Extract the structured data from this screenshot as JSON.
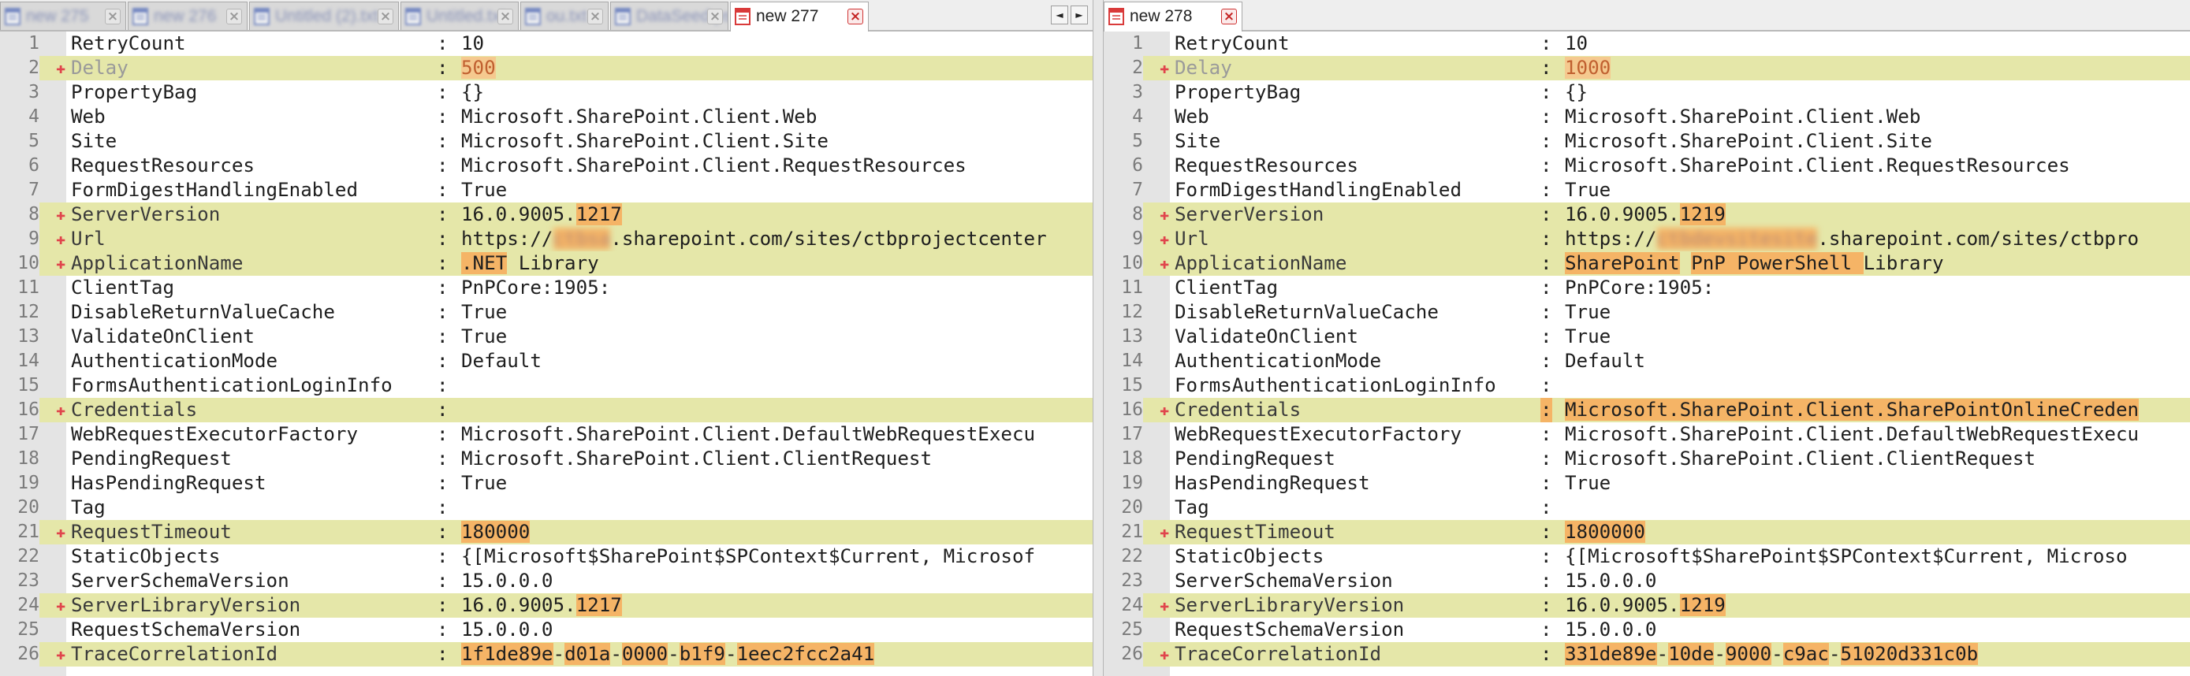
{
  "colors": {
    "diff_line_bg": "#e5e7a9",
    "char_highlight": "#f5b466",
    "marker": "#e0454c",
    "gutter": "#e4e4e4"
  },
  "left": {
    "tabs": [
      {
        "label": "new 275",
        "icon": "notepad-file-icon",
        "blurred": true
      },
      {
        "label": "new 276",
        "icon": "notepad-file-icon",
        "blurred": true
      },
      {
        "label": "Untitled (2).txt",
        "icon": "notepad-file-icon",
        "blurred": true
      },
      {
        "label": "Untitled.txt",
        "icon": "notepad-file-icon",
        "blurred": true
      },
      {
        "label": "ou.txt",
        "icon": "notepad-file-icon",
        "blurred": true
      },
      {
        "label": "DataSeed.ps1",
        "icon": "notepad-file-icon",
        "blurred": true
      },
      {
        "label": "new 277",
        "icon": "notepad-file-red-icon",
        "blurred": false,
        "active": true
      }
    ],
    "scroll_left": "◄",
    "scroll_right": "►",
    "lines": [
      {
        "n": "1",
        "k": "RetryCount",
        "v": [
          {
            "t": "10"
          }
        ]
      },
      {
        "n": "2",
        "d": true,
        "dim": true,
        "k": "Delay",
        "v": [
          {
            "t": "500",
            "h": true
          }
        ]
      },
      {
        "n": "3",
        "k": "PropertyBag",
        "v": [
          {
            "t": "{}"
          }
        ]
      },
      {
        "n": "4",
        "k": "Web",
        "v": [
          {
            "t": "Microsoft.SharePoint.Client.Web"
          }
        ]
      },
      {
        "n": "5",
        "k": "Site",
        "v": [
          {
            "t": "Microsoft.SharePoint.Client.Site"
          }
        ]
      },
      {
        "n": "6",
        "k": "RequestResources",
        "v": [
          {
            "t": "Microsoft.SharePoint.Client.RequestResources"
          }
        ]
      },
      {
        "n": "7",
        "k": "FormDigestHandlingEnabled",
        "v": [
          {
            "t": "True"
          }
        ]
      },
      {
        "n": "8",
        "d": true,
        "k": "ServerVersion",
        "v": [
          {
            "t": "16.0.9005."
          },
          {
            "t": "1217",
            "h": true
          }
        ]
      },
      {
        "n": "9",
        "d": true,
        "k": "Url",
        "v": [
          {
            "t": "https://"
          },
          {
            "t": "ctbsa",
            "h": true,
            "b": true
          },
          {
            "t": ".sharepoint.com/sites/ctbprojectcenter"
          }
        ]
      },
      {
        "n": "10",
        "d": true,
        "k": "ApplicationName",
        "v": [
          {
            "t": ".NET",
            "h": true
          },
          {
            "t": " Library"
          }
        ]
      },
      {
        "n": "11",
        "k": "ClientTag",
        "v": [
          {
            "t": "PnPCore:1905:"
          }
        ]
      },
      {
        "n": "12",
        "k": "DisableReturnValueCache",
        "v": [
          {
            "t": "True"
          }
        ]
      },
      {
        "n": "13",
        "k": "ValidateOnClient",
        "v": [
          {
            "t": "True"
          }
        ]
      },
      {
        "n": "14",
        "k": "AuthenticationMode",
        "v": [
          {
            "t": "Default"
          }
        ]
      },
      {
        "n": "15",
        "k": "FormsAuthenticationLoginInfo",
        "v": []
      },
      {
        "n": "16",
        "d": true,
        "k": "Credentials",
        "v": []
      },
      {
        "n": "17",
        "k": "WebRequestExecutorFactory",
        "v": [
          {
            "t": "Microsoft.SharePoint.Client.DefaultWebRequestExecu"
          }
        ]
      },
      {
        "n": "18",
        "k": "PendingRequest",
        "v": [
          {
            "t": "Microsoft.SharePoint.Client.ClientRequest"
          }
        ]
      },
      {
        "n": "19",
        "k": "HasPendingRequest",
        "v": [
          {
            "t": "True"
          }
        ]
      },
      {
        "n": "20",
        "k": "Tag",
        "v": []
      },
      {
        "n": "21",
        "d": true,
        "k": "RequestTimeout",
        "v": [
          {
            "t": "180000",
            "h": true
          }
        ]
      },
      {
        "n": "22",
        "k": "StaticObjects",
        "v": [
          {
            "t": "{[Microsoft$SharePoint$SPContext$Current, Microsof"
          }
        ]
      },
      {
        "n": "23",
        "k": "ServerSchemaVersion",
        "v": [
          {
            "t": "15.0.0.0"
          }
        ]
      },
      {
        "n": "24",
        "d": true,
        "k": "ServerLibraryVersion",
        "v": [
          {
            "t": "16.0.9005."
          },
          {
            "t": "1217",
            "h": true
          }
        ]
      },
      {
        "n": "25",
        "k": "RequestSchemaVersion",
        "v": [
          {
            "t": "15.0.0.0"
          }
        ]
      },
      {
        "n": "26",
        "d": true,
        "k": "TraceCorrelationId",
        "v": [
          {
            "t": "1f1de89e",
            "h": true
          },
          {
            "t": "-"
          },
          {
            "t": "d01a",
            "h": true
          },
          {
            "t": "-"
          },
          {
            "t": "0000",
            "h": true
          },
          {
            "t": "-"
          },
          {
            "t": "b1f9",
            "h": true
          },
          {
            "t": "-"
          },
          {
            "t": "1eec2fcc2a41",
            "h": true
          }
        ]
      }
    ]
  },
  "right": {
    "tabs": [
      {
        "label": "new 278",
        "icon": "notepad-file-red-icon",
        "blurred": false,
        "active": true
      }
    ],
    "lines": [
      {
        "n": "1",
        "k": "RetryCount",
        "v": [
          {
            "t": "10"
          }
        ]
      },
      {
        "n": "2",
        "d": true,
        "dim": true,
        "k": "Delay",
        "v": [
          {
            "t": "1000",
            "h": true
          }
        ]
      },
      {
        "n": "3",
        "k": "PropertyBag",
        "v": [
          {
            "t": "{}"
          }
        ]
      },
      {
        "n": "4",
        "k": "Web",
        "v": [
          {
            "t": "Microsoft.SharePoint.Client.Web"
          }
        ]
      },
      {
        "n": "5",
        "k": "Site",
        "v": [
          {
            "t": "Microsoft.SharePoint.Client.Site"
          }
        ]
      },
      {
        "n": "6",
        "k": "RequestResources",
        "v": [
          {
            "t": "Microsoft.SharePoint.Client.RequestResources"
          }
        ]
      },
      {
        "n": "7",
        "k": "FormDigestHandlingEnabled",
        "v": [
          {
            "t": "True"
          }
        ]
      },
      {
        "n": "8",
        "d": true,
        "k": "ServerVersion",
        "v": [
          {
            "t": "16.0.9005."
          },
          {
            "t": "1219",
            "h": true
          }
        ]
      },
      {
        "n": "9",
        "d": true,
        "k": "Url",
        "v": [
          {
            "t": "https://"
          },
          {
            "t": "ctbdevsitesite",
            "h": true,
            "b": true
          },
          {
            "t": ".sharepoint.com/sites/ctbpro"
          }
        ]
      },
      {
        "n": "10",
        "d": true,
        "k": "ApplicationName",
        "v": [
          {
            "t": "SharePoint",
            "h": true
          },
          {
            "t": " "
          },
          {
            "t": "PnP PowerShell ",
            "h": true
          },
          {
            "t": "Library"
          }
        ]
      },
      {
        "n": "11",
        "k": "ClientTag",
        "v": [
          {
            "t": "PnPCore:1905:"
          }
        ]
      },
      {
        "n": "12",
        "k": "DisableReturnValueCache",
        "v": [
          {
            "t": "True"
          }
        ]
      },
      {
        "n": "13",
        "k": "ValidateOnClient",
        "v": [
          {
            "t": "True"
          }
        ]
      },
      {
        "n": "14",
        "k": "AuthenticationMode",
        "v": [
          {
            "t": "Default"
          }
        ]
      },
      {
        "n": "15",
        "k": "FormsAuthenticationLoginInfo",
        "v": []
      },
      {
        "n": "16",
        "d": true,
        "k": "Credentials",
        "sh": true,
        "v": [
          {
            "t": "Microsoft.SharePoint.Client.SharePointOnlineCreden",
            "h": true
          }
        ]
      },
      {
        "n": "17",
        "k": "WebRequestExecutorFactory",
        "v": [
          {
            "t": "Microsoft.SharePoint.Client.DefaultWebRequestExecu"
          }
        ]
      },
      {
        "n": "18",
        "k": "PendingRequest",
        "v": [
          {
            "t": "Microsoft.SharePoint.Client.ClientRequest"
          }
        ]
      },
      {
        "n": "19",
        "k": "HasPendingRequest",
        "v": [
          {
            "t": "True"
          }
        ]
      },
      {
        "n": "20",
        "k": "Tag",
        "v": []
      },
      {
        "n": "21",
        "d": true,
        "k": "RequestTimeout",
        "v": [
          {
            "t": "1800000",
            "h": true
          }
        ]
      },
      {
        "n": "22",
        "k": "StaticObjects",
        "v": [
          {
            "t": "{[Microsoft$SharePoint$SPContext$Current, Microso"
          }
        ]
      },
      {
        "n": "23",
        "k": "ServerSchemaVersion",
        "v": [
          {
            "t": "15.0.0.0"
          }
        ]
      },
      {
        "n": "24",
        "d": true,
        "k": "ServerLibraryVersion",
        "v": [
          {
            "t": "16.0.9005."
          },
          {
            "t": "1219",
            "h": true
          }
        ]
      },
      {
        "n": "25",
        "k": "RequestSchemaVersion",
        "v": [
          {
            "t": "15.0.0.0"
          }
        ]
      },
      {
        "n": "26",
        "d": true,
        "k": "TraceCorrelationId",
        "v": [
          {
            "t": "331de89e",
            "h": true
          },
          {
            "t": "-"
          },
          {
            "t": "10de",
            "h": true
          },
          {
            "t": "-"
          },
          {
            "t": "9000",
            "h": true
          },
          {
            "t": "-"
          },
          {
            "t": "c9ac",
            "h": true
          },
          {
            "t": "-"
          },
          {
            "t": "51020d331c0b",
            "h": true
          }
        ]
      }
    ]
  }
}
